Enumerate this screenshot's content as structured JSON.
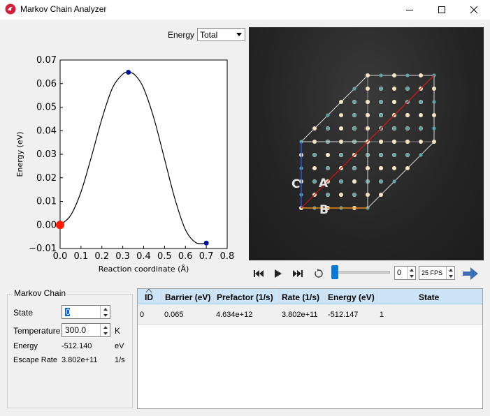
{
  "window": {
    "title": "Markov Chain Analyzer"
  },
  "energy_control": {
    "label": "Energy",
    "selected": "Total"
  },
  "chart_data": {
    "type": "line",
    "xlabel": "Reaction coordinate (Å)",
    "ylabel": "Energy (eV)",
    "xlim": [
      0,
      0.8
    ],
    "ylim": [
      -0.01,
      0.07
    ],
    "xticks": [
      "0.0",
      "0.1",
      "0.2",
      "0.3",
      "0.4",
      "0.5",
      "0.6",
      "0.7",
      "0.8"
    ],
    "yticks": [
      "−0.01",
      "0.00",
      "0.01",
      "0.02",
      "0.03",
      "0.04",
      "0.05",
      "0.06",
      "0.07"
    ],
    "curve": {
      "x": [
        0.0,
        0.05,
        0.1,
        0.15,
        0.2,
        0.25,
        0.3,
        0.33,
        0.36,
        0.4,
        0.45,
        0.5,
        0.55,
        0.6,
        0.65,
        0.7
      ],
      "y": [
        0.0,
        0.004,
        0.014,
        0.029,
        0.045,
        0.058,
        0.064,
        0.0648,
        0.0635,
        0.058,
        0.045,
        0.028,
        0.011,
        -0.002,
        -0.0075,
        -0.0077
      ]
    },
    "points": [
      {
        "x": 0.0,
        "y": 0.0,
        "color": "#ff1a00",
        "kind": "current"
      },
      {
        "x": 0.327,
        "y": 0.0648,
        "color": "#0010a0",
        "kind": "saddle"
      },
      {
        "x": 0.7,
        "y": -0.0077,
        "color": "#0010a0",
        "kind": "final"
      }
    ]
  },
  "viewer": {
    "axis_labels": {
      "a": "A",
      "b": "B",
      "c": "C"
    }
  },
  "playback": {
    "frame": "0",
    "fps": "25 FPS",
    "progress": 0.0
  },
  "markov_chain": {
    "title": "Markov Chain",
    "state_label": "State",
    "state_value": "0",
    "temperature_label": "Temperature",
    "temperature_value": "300.0",
    "temperature_unit": "K",
    "energy_label": "Energy",
    "energy_value": "-512.140",
    "energy_unit": "eV",
    "escape_label": "Escape Rate",
    "escape_value": "3.802e+11",
    "escape_unit": "1/s"
  },
  "table": {
    "headers": [
      "ID",
      "Barrier (eV)",
      "Prefactor (1/s)",
      "Rate (1/s)",
      "Energy (eV)",
      "State"
    ],
    "rows": [
      [
        "0",
        "0.065",
        "4.634e+12",
        "3.802e+11",
        "-512.147",
        "1"
      ]
    ]
  }
}
